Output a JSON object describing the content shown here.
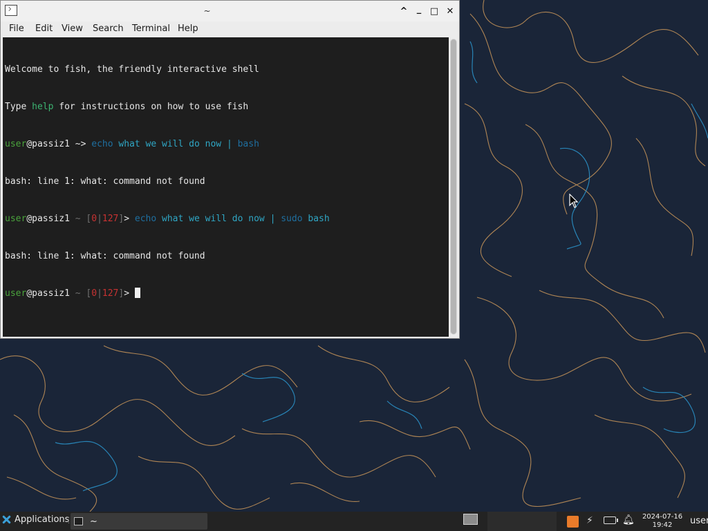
{
  "window": {
    "title": "~",
    "controls": {
      "maximize": "^",
      "minimize": "_",
      "restore": "□",
      "close": "✕"
    },
    "menu": [
      "File",
      "Edit",
      "View",
      "Search",
      "Terminal",
      "Help"
    ]
  },
  "terminal": {
    "welcome": "Welcome to fish, the friendly interactive shell",
    "type_prefix": "Type ",
    "help_word": "help",
    "type_suffix": " for instructions on how to use fish",
    "user": "user",
    "at_host": "@passiz1",
    "arrow_prompt": " ~> ",
    "tilde": " ~ ",
    "status_open": "[",
    "status_code1": "0",
    "status_pipe": "|",
    "status_code2": "127",
    "status_close": "]",
    "gt": "> ",
    "cmd1_echo": "echo",
    "cmd1_args": " what we will do now ",
    "cmd1_pipe": "| ",
    "cmd1_bash": "bash",
    "error": "bash: line 1: what: command not found",
    "cmd2_echo": "echo",
    "cmd2_args": " what we will do now ",
    "cmd2_pipe": "| ",
    "cmd2_sudo": "sudo",
    "cmd2_bash": " bash"
  },
  "taskbar": {
    "applications": "Applications",
    "separator": "⋮",
    "task_title": "~",
    "date": "2024-07-16",
    "time": "19:42",
    "user": "user"
  },
  "colors": {
    "desktop_bg": "#1a2538",
    "line_orange": "#c9965a",
    "line_blue": "#2a8fc4",
    "terminal_bg": "#1e1e1e",
    "prompt_green": "#4aa33c",
    "status_red": "#c83232",
    "cmd_cyan": "#2fa6c4"
  }
}
